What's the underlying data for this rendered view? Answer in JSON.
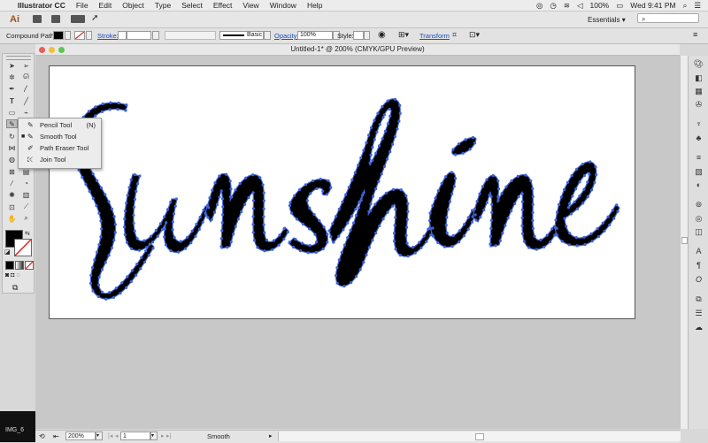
{
  "menubar": {
    "app_name": "Illustrator CC",
    "items": [
      "File",
      "Edit",
      "Object",
      "Type",
      "Select",
      "Effect",
      "View",
      "Window",
      "Help"
    ],
    "battery": "100%",
    "clock": "Wed 9:41 PM"
  },
  "appbar": {
    "logo": "Ai",
    "workspace": "Essentials",
    "search_placeholder": ""
  },
  "control_bar": {
    "selection_type": "Compound Path",
    "stroke_label": "Stroke:",
    "brush_label": "Basic",
    "opacity_label": "Opacity:",
    "opacity_value": "100%",
    "style_label": "Style:",
    "transform_label": "Transform"
  },
  "tool_flyout": {
    "items": [
      {
        "label": "Pencil Tool",
        "shortcut": "(N)",
        "selected": false
      },
      {
        "label": "Smooth Tool",
        "shortcut": "",
        "selected": true
      },
      {
        "label": "Path Eraser Tool",
        "shortcut": "",
        "selected": false
      },
      {
        "label": "Join Tool",
        "shortcut": "",
        "selected": false
      }
    ]
  },
  "document": {
    "title": "Untitled-1* @ 200% (CMYK/GPU Preview)",
    "artwork_word": "Sunshine"
  },
  "status_bar": {
    "zoom": "200%",
    "artboard": "1",
    "current_tool": "Smooth"
  },
  "dock": {
    "label": "IMG_6"
  },
  "colors": {
    "path_anchor": "#3e64d8",
    "artwork_fill": "#000000",
    "link_blue": "#1a4fb8"
  }
}
